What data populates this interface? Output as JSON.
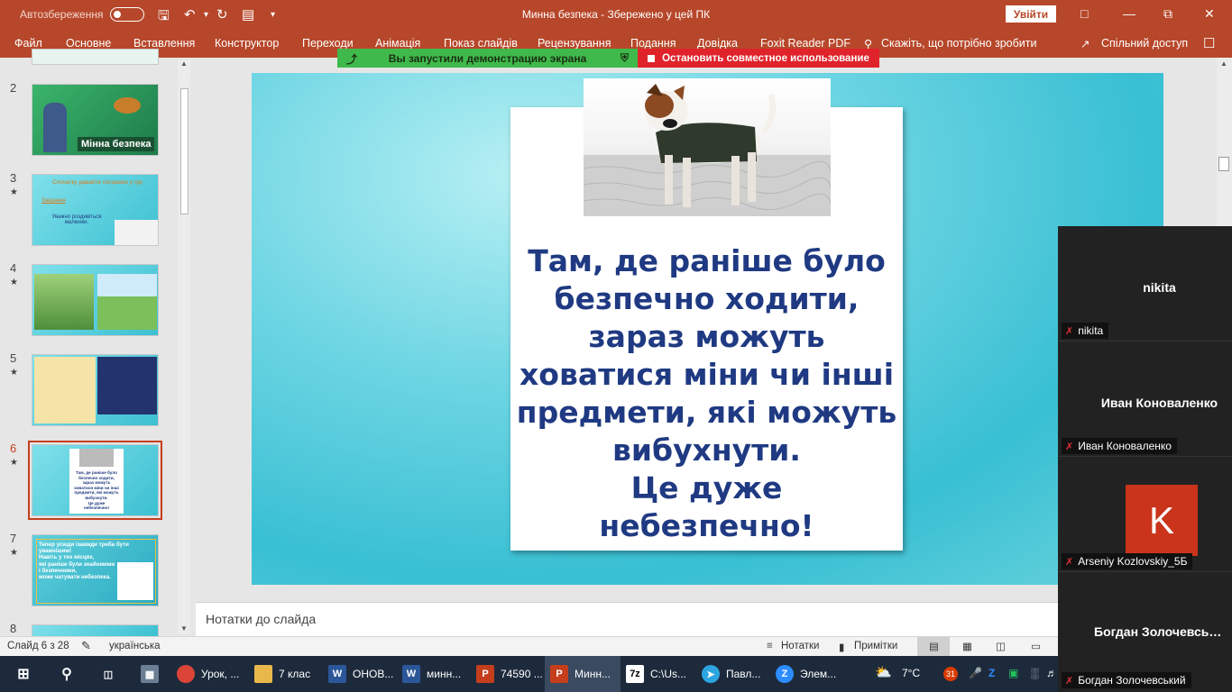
{
  "titlebar": {
    "autosave_label": "Автозбереження",
    "doc_title": "Минна безпека  -  Збережено у цей ПК",
    "signin_label": "Увійти"
  },
  "ribbon": {
    "tabs": [
      "Файл",
      "Основне",
      "Вставлення",
      "Конструктор",
      "Переходи",
      "Анімація",
      "Показ слайдів",
      "Рецензування",
      "Подання",
      "Довідка",
      "Foxit Reader PDF",
      "Скажіть, що потрібно зробити"
    ],
    "share_label": "Спільний доступ"
  },
  "screen_share": {
    "status_text": "Вы запустили демонстрацию экрана",
    "stop_text": "Остановить совместное использование"
  },
  "thumbnails": {
    "numbers": [
      "2",
      "3",
      "4",
      "5",
      "6",
      "7",
      "8"
    ],
    "active": "6",
    "slide2_caption": "Мінна безпека",
    "slide3_lines": [
      "Спочатку давайте пограємо у гру",
      "Завдання",
      "Уважно роздивіться малюнки."
    ],
    "slide7_lines": [
      "Тепер усюди ізавжди треба бути уважнішим!",
      "Навіть у тих місцях,",
      "які раніше були знайомими",
      "і безпечними,",
      "може чатувати небезпека."
    ]
  },
  "slide": {
    "text_lines": [
      "Там, де раніше було",
      "безпечно ходити,",
      "зараз можуть",
      "ховатися міни чи інші",
      "предмети, які можуть",
      "вибухнути.",
      "Це дуже",
      "небезпечно!"
    ]
  },
  "notes_placeholder": "Нотатки до слайда",
  "status": {
    "slide_counter": "Слайд 6 з 28",
    "language": "українська",
    "notes_label": "Нотатки",
    "comments_label": "Примітки"
  },
  "participants": [
    {
      "display": "nikita",
      "label": "nikita"
    },
    {
      "display": "Иван  Коноваленко",
      "label": "Иван Коноваленко"
    },
    {
      "display": "K",
      "label": "Arseniy Kozlovskiy_5Б"
    },
    {
      "display": "Богдан  Золочевський",
      "label": "Богдан Золочевський"
    }
  ],
  "taskbar": {
    "items": [
      "Урок, ...",
      "7 клас",
      "ОНОВ...",
      "минн...",
      "74590 ...",
      "Минн...",
      "C:\\Us...",
      "Павл...",
      "Элем..."
    ],
    "temperature": "7°C",
    "calendar_badge": "31"
  },
  "colors": {
    "accent": "#b7472a",
    "slide_text": "#1f3a82",
    "share_green": "#3fb94b",
    "share_red": "#e0232b",
    "avatar": "#c9341a"
  }
}
